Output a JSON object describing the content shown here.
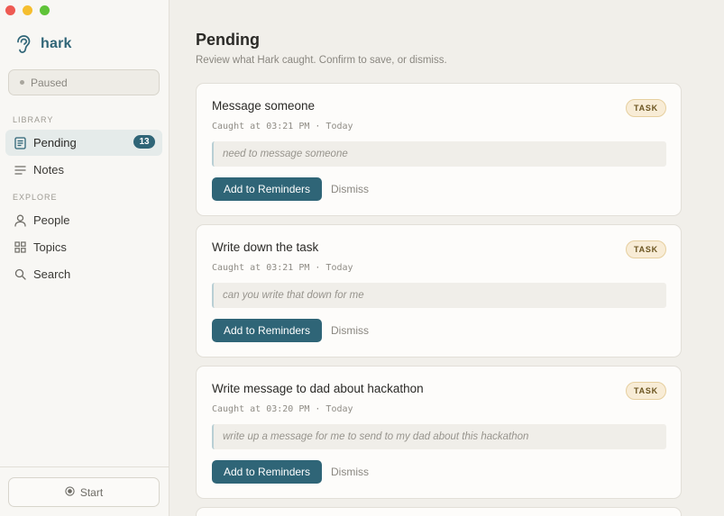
{
  "app": {
    "name": "hark"
  },
  "colors": {
    "accent": "#2f6577",
    "tag_bg": "#f8ecd6",
    "background": "#f1efea"
  },
  "sidebar": {
    "status": "Paused",
    "sections": [
      {
        "label": "LIBRARY",
        "items": [
          {
            "label": "Pending",
            "icon": "document-icon",
            "badge": "13",
            "active": true
          },
          {
            "label": "Notes",
            "icon": "lines-icon"
          }
        ]
      },
      {
        "label": "EXPLORE",
        "items": [
          {
            "label": "People",
            "icon": "person-icon"
          },
          {
            "label": "Topics",
            "icon": "grid-icon"
          },
          {
            "label": "Search",
            "icon": "search-icon"
          }
        ]
      }
    ],
    "start_label": "Start"
  },
  "main": {
    "title": "Pending",
    "subtitle": "Review what Hark caught. Confirm to save, or dismiss.",
    "cards": [
      {
        "title": "Message someone",
        "tag": "TASK",
        "caught": "Caught at 03:21 PM · Today",
        "quote": "need to message someone",
        "primary": "Add to Reminders",
        "secondary": "Dismiss"
      },
      {
        "title": "Write down the task",
        "tag": "TASK",
        "caught": "Caught at 03:21 PM · Today",
        "quote": "can you write that down for me",
        "primary": "Add to Reminders",
        "secondary": "Dismiss"
      },
      {
        "title": "Write message to dad about hackathon",
        "tag": "TASK",
        "caught": "Caught at 03:20 PM · Today",
        "quote": "write up a message for me to send to my dad about this hackathon",
        "primary": "Add to Reminders",
        "secondary": "Dismiss"
      }
    ]
  }
}
